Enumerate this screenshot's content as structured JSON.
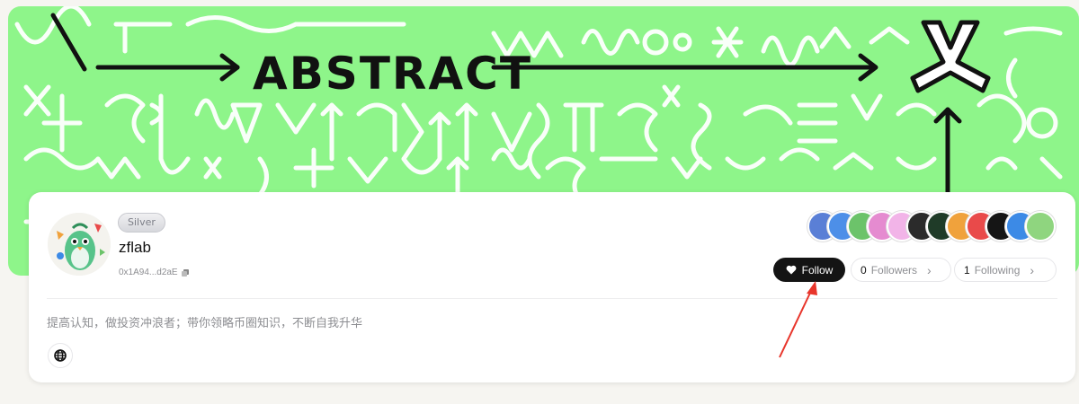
{
  "banner": {
    "title": "ABSTRACT"
  },
  "profile": {
    "tier": "Silver",
    "username": "zflab",
    "address": "0x1A94...d2aE",
    "bio": "提高认知，做投资冲浪者；带你领略币圈知识，不断自我升华"
  },
  "actions": {
    "follow_label": "Follow",
    "followers_count": "0",
    "followers_label": "Followers",
    "following_count": "1",
    "following_label": "Following"
  },
  "badges": [
    {
      "icon": "x-badge-icon",
      "color": "#5a7fd6"
    },
    {
      "icon": "blue-badge-icon",
      "color": "#4d8fe8"
    },
    {
      "icon": "green-badge-icon",
      "color": "#6cc36a"
    },
    {
      "icon": "pink-badge-icon",
      "color": "#e58bd0"
    },
    {
      "icon": "pink-square-badge-icon",
      "color": "#f2b4e8"
    },
    {
      "icon": "dark-badge-icon",
      "color": "#2b2b2b"
    },
    {
      "icon": "skull-badge-icon",
      "color": "#1f3b28"
    },
    {
      "icon": "orange-badge-icon",
      "color": "#f0a23c"
    },
    {
      "icon": "red-badge-icon",
      "color": "#e94a4a"
    },
    {
      "icon": "black-badge-icon",
      "color": "#151515"
    },
    {
      "icon": "blue-bird-badge-icon",
      "color": "#3c8ae6"
    },
    {
      "icon": "green-diamond-badge-icon",
      "color": "#8fd57f"
    }
  ],
  "colors": {
    "banner_bg": "#8ef58a",
    "follow_bg": "#141414",
    "annotation": "#e8352b"
  }
}
